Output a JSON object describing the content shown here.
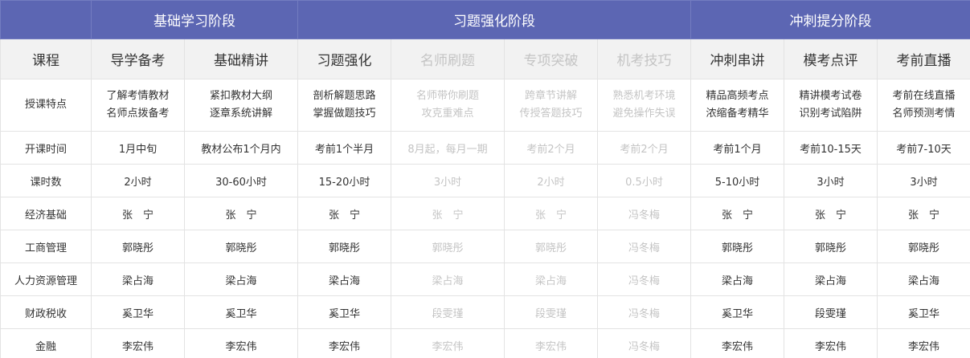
{
  "stages": [
    "",
    "基础学习阶段",
    "习题强化阶段",
    "冲刺提分阶段"
  ],
  "course_header": "课程",
  "courses": [
    {
      "name": "导学备考",
      "active": true
    },
    {
      "name": "基础精讲",
      "active": true
    },
    {
      "name": "习题强化",
      "active": true
    },
    {
      "name": "名师刷题",
      "active": false
    },
    {
      "name": "专项突破",
      "active": false
    },
    {
      "name": "机考技巧",
      "active": false
    },
    {
      "name": "冲刺串讲",
      "active": true
    },
    {
      "name": "模考点评",
      "active": true
    },
    {
      "name": "考前直播",
      "active": true
    }
  ],
  "features": {
    "label": "授课特点",
    "cells": [
      [
        "了解考情教材",
        "名师点拨备考"
      ],
      [
        "紧扣教材大纲",
        "逐章系统讲解"
      ],
      [
        "剖析解题思路",
        "掌握做题技巧"
      ],
      [
        "名师带你刷题",
        "攻克重难点"
      ],
      [
        "跨章节讲解",
        "传授答题技巧"
      ],
      [
        "熟悉机考环境",
        "避免操作失误"
      ],
      [
        "精品高频考点",
        "浓缩备考精华"
      ],
      [
        "精讲模考试卷",
        "识别考试陷阱"
      ],
      [
        "考前在线直播",
        "名师预测考情"
      ]
    ]
  },
  "rows": [
    {
      "label": "开课时间",
      "cells": [
        "1月中旬",
        "教材公布1个月内",
        "考前1个半月",
        "8月起，每月一期",
        "考前2个月",
        "考前2个月",
        "考前1个月",
        "考前10-15天",
        "考前7-10天"
      ]
    },
    {
      "label": "课时数",
      "cells": [
        "2小时",
        "30-60小时",
        "15-20小时",
        "3小时",
        "2小时",
        "0.5小时",
        "5-10小时",
        "3小时",
        "3小时"
      ]
    },
    {
      "label": "经济基础",
      "cells": [
        "张　宁",
        "张　宁",
        "张　宁",
        "张　宁",
        "张　宁",
        "冯冬梅",
        "张　宁",
        "张　宁",
        "张　宁"
      ]
    },
    {
      "label": "工商管理",
      "cells": [
        "郭晓彤",
        "郭晓彤",
        "郭晓彤",
        "郭晓彤",
        "郭晓彤",
        "冯冬梅",
        "郭晓彤",
        "郭晓彤",
        "郭晓彤"
      ]
    },
    {
      "label": "人力资源管理",
      "cells": [
        "梁占海",
        "梁占海",
        "梁占海",
        "梁占海",
        "梁占海",
        "冯冬梅",
        "梁占海",
        "梁占海",
        "梁占海"
      ]
    },
    {
      "label": "财政税收",
      "cells": [
        "奚卫华",
        "奚卫华",
        "奚卫华",
        "段雯瑾",
        "段雯瑾",
        "冯冬梅",
        "奚卫华",
        "段雯瑾",
        "奚卫华"
      ]
    },
    {
      "label": "金融",
      "cells": [
        "李宏伟",
        "李宏伟",
        "李宏伟",
        "李宏伟",
        "李宏伟",
        "冯冬梅",
        "李宏伟",
        "李宏伟",
        "李宏伟"
      ]
    }
  ],
  "colors": {
    "stage_bg": "#5c66b3",
    "header_bg": "#f2f2f2",
    "dim_text": "#c4c4c4",
    "text": "#333333"
  }
}
